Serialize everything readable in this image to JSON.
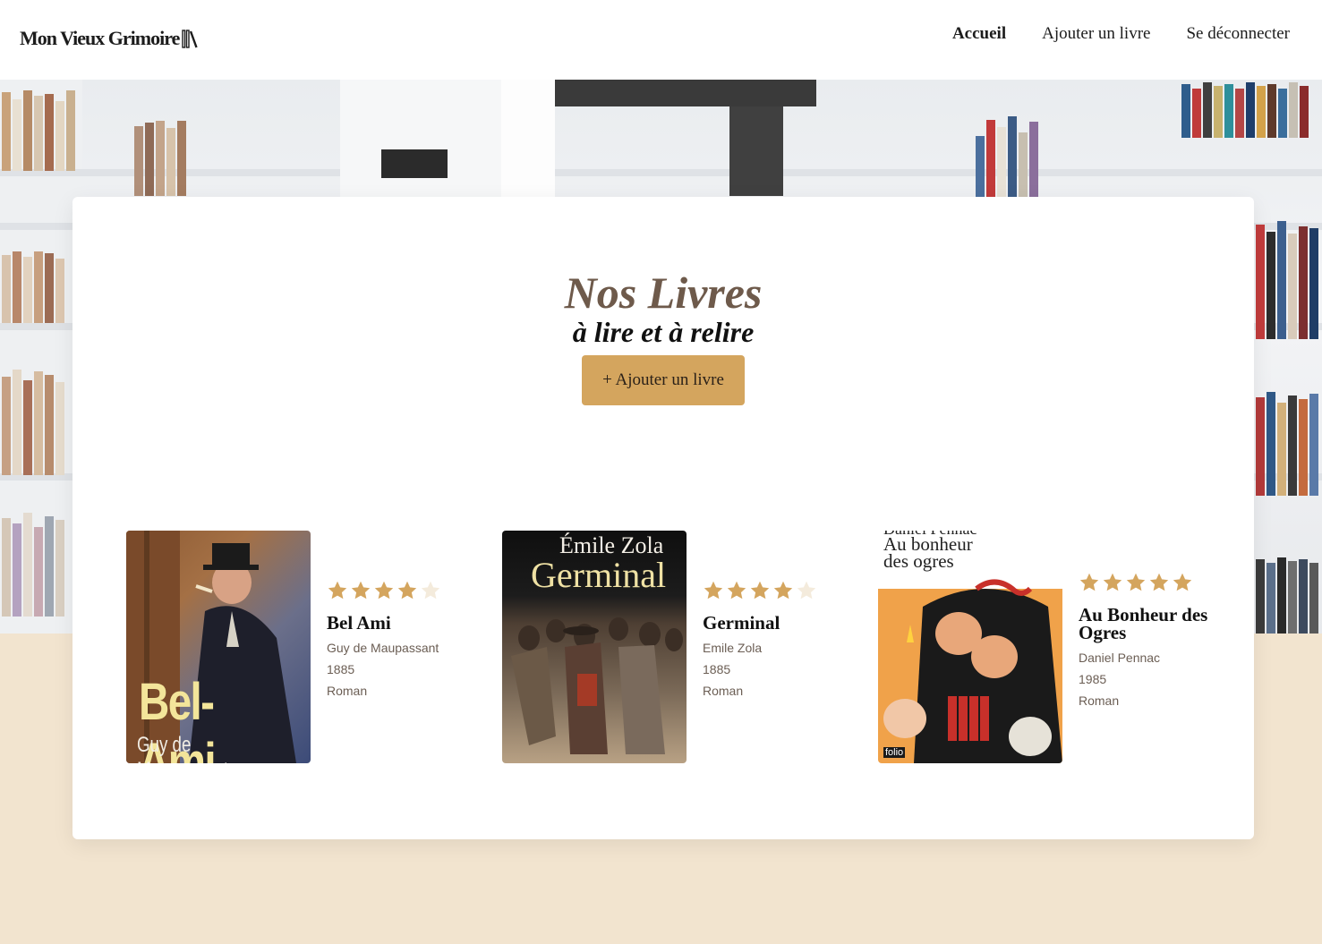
{
  "header": {
    "logo_text": "Mon Vieux Grimoire",
    "nav": [
      {
        "label": "Accueil",
        "active": true
      },
      {
        "label": "Ajouter un livre",
        "active": false
      },
      {
        "label": "Se déconnecter",
        "active": false
      }
    ]
  },
  "main": {
    "title": "Nos Livres",
    "subtitle": "à lire et à relire",
    "add_button_label": "+ Ajouter un livre"
  },
  "books": [
    {
      "title": "Bel Ami",
      "author": "Guy de Maupassant",
      "year": "1885",
      "genre": "Roman",
      "rating": 4,
      "cover_title": "Bel-Ami",
      "cover_author": "Guy de Maupassant"
    },
    {
      "title": "Germinal",
      "author": "Emile Zola",
      "year": "1885",
      "genre": "Roman",
      "rating": 4,
      "cover_title": "Germinal",
      "cover_author": "Émile Zola"
    },
    {
      "title": "Au Bonheur des Ogres",
      "author": "Daniel Pennac",
      "year": "1985",
      "genre": "Roman",
      "rating": 5,
      "cover_title": "Au bonheur des ogres",
      "cover_author": "Daniel Pennac",
      "cover_publisher": "folio"
    }
  ],
  "colors": {
    "accent": "#d4a55e",
    "star_filled": "#d4a55e",
    "star_empty": "#f4ebdc",
    "page_background": "#f2e4cf",
    "title_color": "#6e5a4b"
  },
  "icons": {
    "logo": "books-icon",
    "rating": "star-icon"
  }
}
